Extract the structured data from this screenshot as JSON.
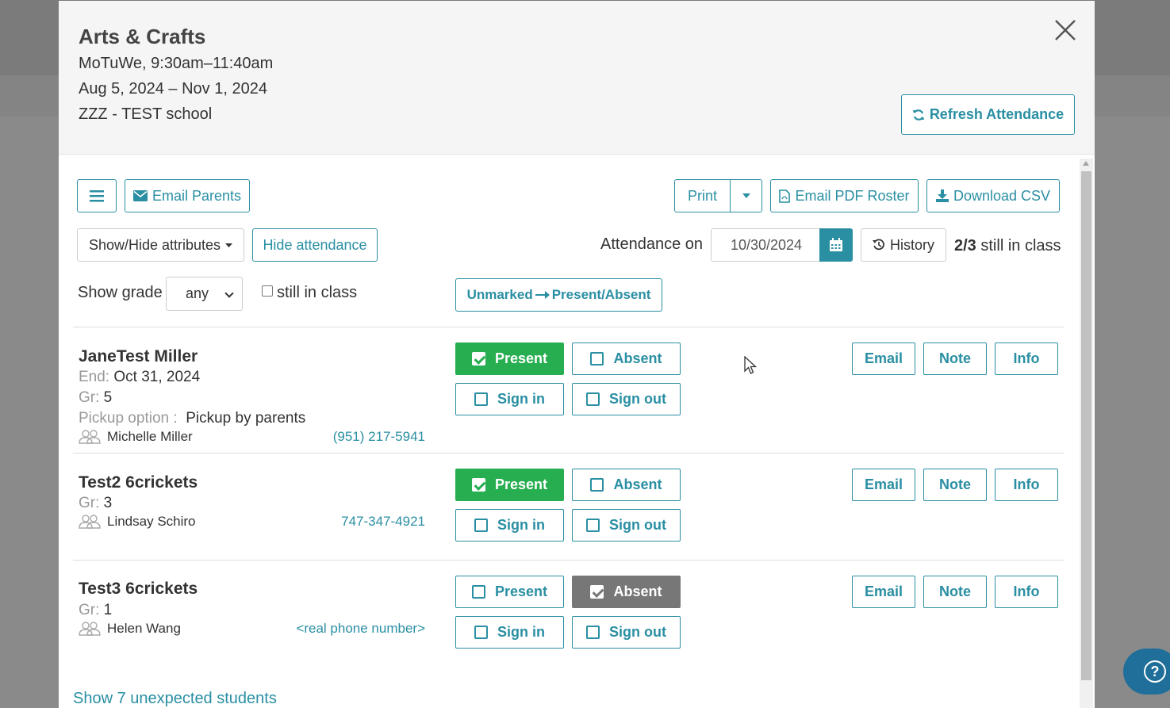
{
  "modal": {
    "title": "Arts & Crafts",
    "schedule": "MoTuWe, 9:30am–11:40am",
    "dates": "Aug 5, 2024 – Nov 1, 2024",
    "school": "ZZZ - TEST school",
    "refresh_label": "Refresh Attendance"
  },
  "toolbar": {
    "email_parents": "Email Parents",
    "print": "Print",
    "email_pdf_roster": "Email PDF Roster",
    "download_csv": "Download CSV",
    "show_hide_attributes": "Show/Hide attributes",
    "hide_attendance": "Hide attendance",
    "attendance_on": "Attendance on",
    "attendance_date": "10/30/2024",
    "history": "History",
    "still_count": "2/3",
    "still_in_class_text": "still in class",
    "show_grade": "Show grade",
    "grade_value": "any",
    "still_in_class_filter": "still in class",
    "unmarked_left": "Unmarked",
    "unmarked_right": "Present/Absent"
  },
  "labels": {
    "end": "End:",
    "grade": "Gr:",
    "pickup": "Pickup option :",
    "present": "Present",
    "absent": "Absent",
    "sign_in": "Sign in",
    "sign_out": "Sign out",
    "email": "Email",
    "note": "Note",
    "info": "Info"
  },
  "students": [
    {
      "name": "JaneTest Miller",
      "end": "Oct 31, 2024",
      "grade": "5",
      "pickup": "Pickup by parents",
      "parent": "Michelle Miller",
      "phone": "(951) 217-5941",
      "status": "present"
    },
    {
      "name": "Test2 6crickets",
      "grade": "3",
      "parent": "Lindsay Schiro",
      "phone": "747-347-4921",
      "status": "present"
    },
    {
      "name": "Test3 6crickets",
      "grade": "1",
      "parent": "Helen Wang",
      "phone": "<real phone number>",
      "status": "absent"
    }
  ],
  "footer": {
    "unexpected_link": "Show 7 unexpected students"
  },
  "colors": {
    "accent": "#2a8fa3",
    "present": "#27ae50",
    "absent": "#777777"
  }
}
